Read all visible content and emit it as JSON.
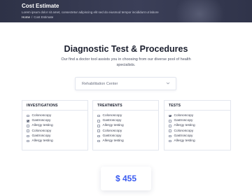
{
  "hero": {
    "title": "Cost Estimate",
    "subtitle": "Lorem ipsum dolor sit amet, consectetur adipiscing elit sed do eiusmod tempor incididunt ut labore",
    "breadcrumb": {
      "home": "Home",
      "separator": "/",
      "current": "Cost Estimate"
    }
  },
  "main": {
    "heading": "Diagnostic Test & Procedures",
    "intro": "Our find a doctor tool assists you in choosing from our diverse pool of health specialists."
  },
  "location_select": {
    "value": "Rehabilitation Center",
    "icon": "chevron-down-icon"
  },
  "panels": [
    {
      "title": "INVESTIGATIONS",
      "items": [
        {
          "label": "Colonoscopy",
          "checked": false
        },
        {
          "label": "Gastroscopy",
          "checked": true
        },
        {
          "label": "Allergy testing",
          "checked": false
        },
        {
          "label": "Colonoscopy",
          "checked": false
        },
        {
          "label": "Gastroscopy",
          "checked": false
        },
        {
          "label": "Allergy testing",
          "checked": false
        }
      ]
    },
    {
      "title": "TREATMENTS",
      "items": [
        {
          "label": "Colonoscopy",
          "checked": false
        },
        {
          "label": "Gastroscopy",
          "checked": false
        },
        {
          "label": "Allergy testing",
          "checked": false
        },
        {
          "label": "Colonoscopy",
          "checked": false
        },
        {
          "label": "Gastroscopy",
          "checked": false
        },
        {
          "label": "Allergy testing",
          "checked": false
        }
      ]
    },
    {
      "title": "TESTS",
      "items": [
        {
          "label": "Colonoscopy",
          "checked": true
        },
        {
          "label": "Gastroscopy",
          "checked": false
        },
        {
          "label": "Allergy testing",
          "checked": false
        },
        {
          "label": "Colonoscopy",
          "checked": false
        },
        {
          "label": "Gastroscopy",
          "checked": false
        },
        {
          "label": "Allergy testing",
          "checked": false
        }
      ]
    }
  ],
  "estimate": {
    "amount": "$ 455"
  },
  "colors": {
    "accent": "#3a5bf0",
    "hero_bg": "#343850",
    "border": "#e3e6ee"
  }
}
